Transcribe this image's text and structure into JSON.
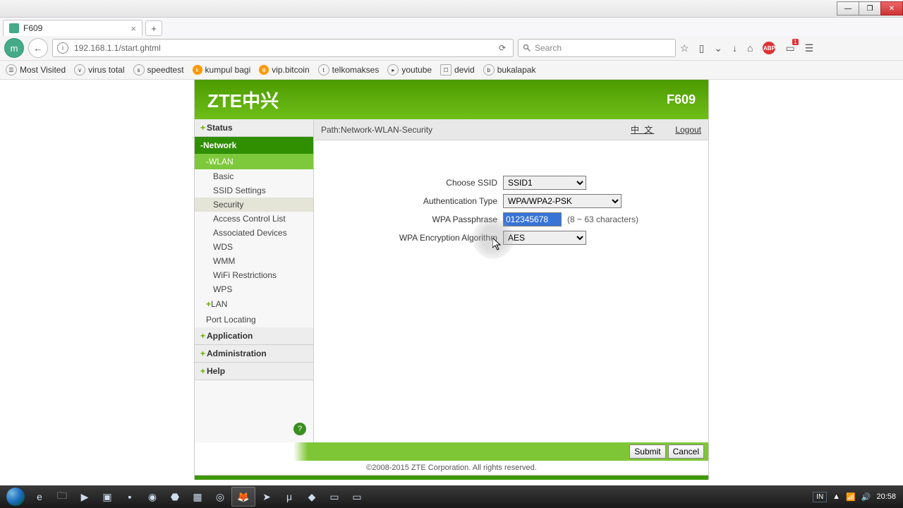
{
  "window": {
    "minimize": "—",
    "maximize": "❐",
    "close": "✕"
  },
  "tab": {
    "title": "F609"
  },
  "url": "192.168.1.1/start.ghtml",
  "search": {
    "placeholder": "Search"
  },
  "toolbar": {
    "notif_count": "1"
  },
  "bookmarks": [
    "Most Visited",
    "virus total",
    "speedtest",
    "kumpul bagi",
    "vip.bitcoin",
    "telkomakses",
    "youtube",
    "devid",
    "bukalapak"
  ],
  "router": {
    "brand": "ZTE中兴",
    "model": "F609",
    "path": "Path:Network-WLAN-Security",
    "lang": "中 文",
    "logout": "Logout",
    "sidebar": {
      "status": "Status",
      "network": "Network",
      "wlan": "WLAN",
      "subs": [
        "Basic",
        "SSID Settings",
        "Security",
        "Access Control List",
        "Associated Devices",
        "WDS",
        "WMM",
        "WiFi Restrictions",
        "WPS"
      ],
      "lan": "LAN",
      "port": "Port Locating",
      "application": "Application",
      "administration": "Administration",
      "help": "Help"
    },
    "form": {
      "ssid_label": "Choose SSID",
      "ssid_value": "SSID1",
      "auth_label": "Authentication Type",
      "auth_value": "WPA/WPA2-PSK",
      "pass_label": "WPA Passphrase",
      "pass_value": "012345678",
      "pass_hint": "(8 ~ 63 characters)",
      "enc_label": "WPA Encryption Algorithm",
      "enc_value": "AES",
      "submit": "Submit",
      "cancel": "Cancel"
    },
    "copyright": "©2008-2015 ZTE Corporation. All rights reserved."
  },
  "taskbar": {
    "lang": "IN",
    "time": "20:58"
  }
}
